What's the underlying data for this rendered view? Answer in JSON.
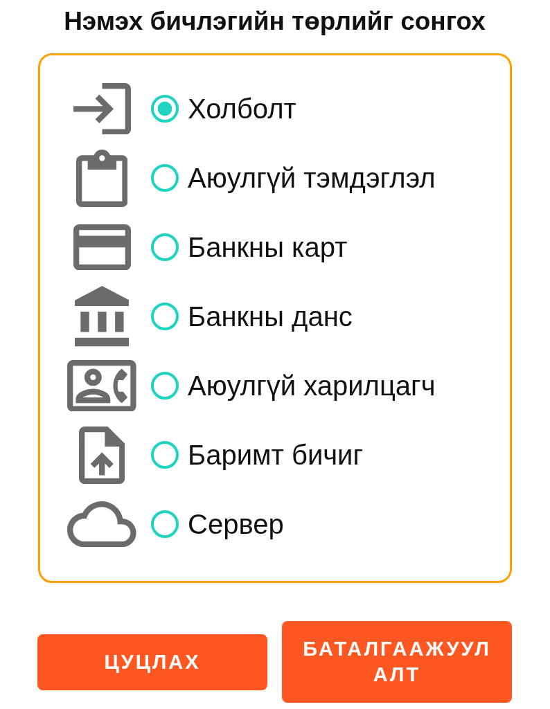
{
  "title": "Нэмэх бичлэгийн төрлийг сонгох",
  "options": [
    {
      "label": "Холболт",
      "selected": true
    },
    {
      "label": "Аюулгүй тэмдэглэл",
      "selected": false
    },
    {
      "label": "Банкны карт",
      "selected": false
    },
    {
      "label": "Банкны данс",
      "selected": false
    },
    {
      "label": "Аюулгүй харилцагч",
      "selected": false
    },
    {
      "label": "Баримт бичиг",
      "selected": false
    },
    {
      "label": "Сервер",
      "selected": false
    }
  ],
  "buttons": [
    {
      "label": "ЦУЦЛАХ"
    },
    {
      "label": "БАТАЛГААЖУУЛАЛТ"
    }
  ]
}
